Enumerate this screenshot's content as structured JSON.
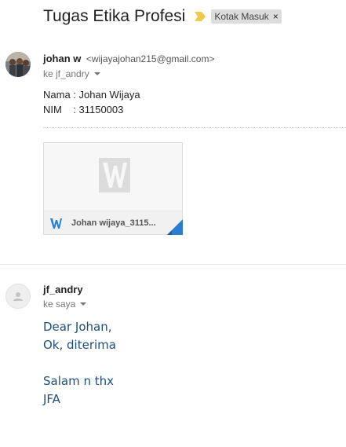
{
  "thread": {
    "subject": "Tugas Etika Profesi",
    "importance_color": "#f2c94c",
    "label": "Kotak Masuk",
    "label_remove": "×"
  },
  "messages": [
    {
      "sender_name": "johan w",
      "sender_email": "<wijayajohan215@gmail.com>",
      "to": "ke jf_andry",
      "body_lines": [
        "Nama : Johan Wijaya",
        "NIM    : 31150003"
      ],
      "attachment": {
        "name": "Johan wijaya_3115...",
        "icon": "word-doc-icon",
        "accent": "#2b7cd3"
      }
    },
    {
      "sender_name": "jf_andry",
      "to": "ke saya",
      "body_lines": [
        "Dear Johan,",
        "Ok, diterima",
        "",
        "Salam n thx",
        "JFA"
      ],
      "body_color": "#1f4e79"
    }
  ]
}
